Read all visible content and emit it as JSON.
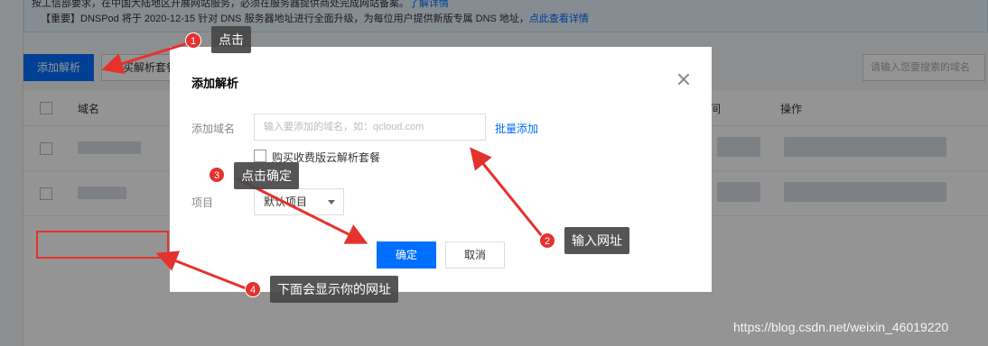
{
  "background": {
    "notice_line1": "按工信部要求，在中国大陆地区开展网站服务，必须在服务器提供商处完成网站备案。",
    "notice_line1_link": "了解详情",
    "notice_line2": "【重要】DNSPod 将于 2020-12-15 针对 DNS 服务器地址进行全面升级，为每位用户提供新版专属 DNS 地址，",
    "notice_line2_link": "点此查看详情",
    "add_button": "添加解析",
    "buy_button": "购买解析套餐",
    "search_placeholder": "请输入您要搜索的域名",
    "col_domain": "域名",
    "col_time": "间",
    "col_ops": "操作"
  },
  "dialog": {
    "title": "添加解析",
    "domain_label": "添加域名",
    "domain_placeholder": "输入要添加的域名，如：qcloud.com",
    "domain_value": "",
    "batch_link": "批量添加",
    "purchase_option": "购买收费版云解析套餐",
    "project_label": "项目",
    "project_value": "默认项目",
    "ok_button": "确定",
    "cancel_button": "取消"
  },
  "annotations": {
    "steps": [
      {
        "number": "1",
        "text": "点击"
      },
      {
        "number": "2",
        "text": "输入网址"
      },
      {
        "number": "3",
        "text": "点击确定"
      },
      {
        "number": "4",
        "text": "下面会显示你的网址"
      }
    ],
    "accent_color": "#e5322d"
  },
  "watermark": "https://blog.csdn.net/weixin_46019220",
  "colors": {
    "primary": "#006eff",
    "overlay": "rgba(0,0,0,0.42)"
  },
  "icons": [
    "close-icon",
    "chevron-down-icon"
  ]
}
